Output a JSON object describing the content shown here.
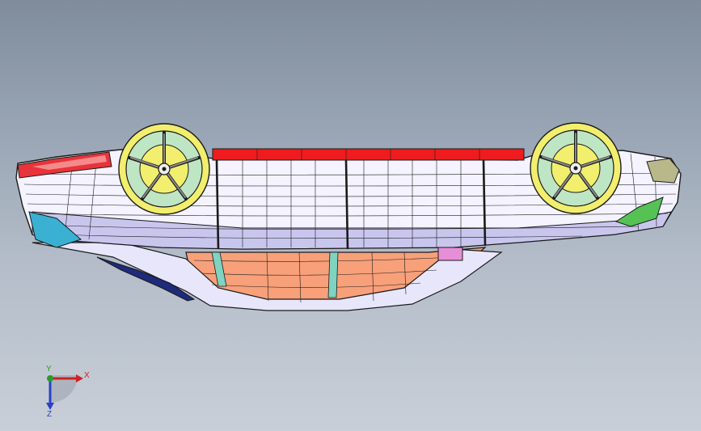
{
  "viewport": {
    "background_top": "#7f8c9c",
    "background_bottom": "#c8cfd8"
  },
  "model": {
    "name": "car-body-wireframe",
    "colors": {
      "body": "#f4f3ff",
      "body_shade": "#c9c6ee",
      "mesh": "#1b1b1b",
      "wheel_rim": "#f2ee6e",
      "wheel_hub": "#bfe6c4",
      "roof_strip": "#ee1c1c",
      "floor_panel": "#f7a07a",
      "tail_lamp": "#e8333a",
      "side_glass": "#3ab0d2",
      "front_lamp": "#56c256",
      "pink_part": "#e78fd6",
      "lower_trim": "#1e2a7a",
      "teal_strip": "#7fd3c0"
    }
  },
  "triad": {
    "x_label": "X",
    "y_label": "Y",
    "z_label": "Z",
    "icon": "coordinate-triad-icon"
  }
}
